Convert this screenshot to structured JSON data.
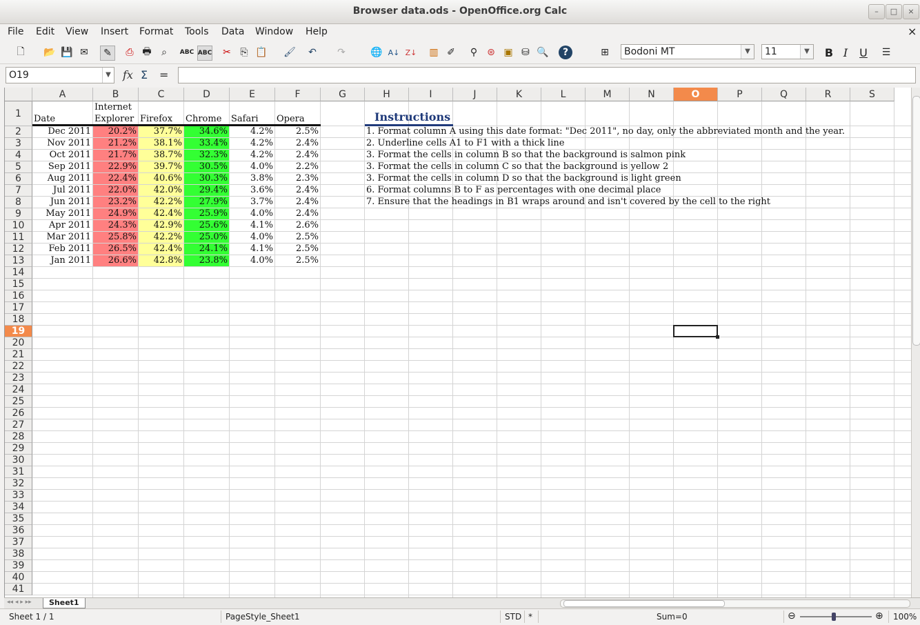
{
  "window": {
    "title": "Browser data.ods - OpenOffice.org Calc"
  },
  "menu": [
    "File",
    "Edit",
    "View",
    "Insert",
    "Format",
    "Tools",
    "Data",
    "Window",
    "Help"
  ],
  "toolbar": {
    "font_name": "Bodoni MT",
    "font_size": "11",
    "bold": "B",
    "italic": "I",
    "underline": "U"
  },
  "formula_bar": {
    "cell_ref": "O19",
    "formula": ""
  },
  "columns": [
    "A",
    "B",
    "C",
    "D",
    "E",
    "F",
    "G",
    "H",
    "I",
    "J",
    "K",
    "L",
    "M",
    "N",
    "O",
    "P",
    "Q",
    "R",
    "S"
  ],
  "selected_column": "O",
  "selected_row": "19",
  "row_count": 41,
  "headers": {
    "a": "Date",
    "b_line1": "Internet",
    "b_line2": "Explorer",
    "c": "Firefox",
    "d": "Chrome",
    "e": "Safari",
    "f": "Opera"
  },
  "rows": [
    [
      "Dec 2011",
      "20.2%",
      "37.7%",
      "34.6%",
      "4.2%",
      "2.5%"
    ],
    [
      "Nov 2011",
      "21.2%",
      "38.1%",
      "33.4%",
      "4.2%",
      "2.4%"
    ],
    [
      "Oct 2011",
      "21.7%",
      "38.7%",
      "32.3%",
      "4.2%",
      "2.4%"
    ],
    [
      "Sep 2011",
      "22.9%",
      "39.7%",
      "30.5%",
      "4.0%",
      "2.2%"
    ],
    [
      "Aug 2011",
      "22.4%",
      "40.6%",
      "30.3%",
      "3.8%",
      "2.3%"
    ],
    [
      "Jul 2011",
      "22.0%",
      "42.0%",
      "29.4%",
      "3.6%",
      "2.4%"
    ],
    [
      "Jun 2011",
      "23.2%",
      "42.2%",
      "27.9%",
      "3.7%",
      "2.4%"
    ],
    [
      "May 2011",
      "24.9%",
      "42.4%",
      "25.9%",
      "4.0%",
      "2.4%"
    ],
    [
      "Apr 2011",
      "24.3%",
      "42.9%",
      "25.6%",
      "4.1%",
      "2.6%"
    ],
    [
      "Mar 2011",
      "25.8%",
      "42.2%",
      "25.0%",
      "4.0%",
      "2.5%"
    ],
    [
      "Feb 2011",
      "26.5%",
      "42.4%",
      "24.1%",
      "4.1%",
      "2.5%"
    ],
    [
      "Jan 2011",
      "26.6%",
      "42.8%",
      "23.8%",
      "4.0%",
      "2.5%"
    ]
  ],
  "instructions": {
    "title": "Instructions",
    "lines": [
      "1. Format column A using this date format: \"Dec 2011\", no day, only the abbreviated month and the year.",
      "2. Underline cells A1 to F1 with a thick line",
      "3. Format the cells in column B so that the background is salmon pink",
      "3. Format the cells in column C so that the background is yellow 2",
      "3. Format the cells in column D so that the background is light green",
      "6. Format columns B to F as percentages with one decimal place",
      "7. Ensure that the headings in B1 wraps around and isn't covered by the cell to the right"
    ]
  },
  "sheet_tab": "Sheet1",
  "status": {
    "sheet": "Sheet 1 / 1",
    "page_style": "PageStyle_Sheet1",
    "mode": "STD",
    "modified": "*",
    "sum": "Sum=0",
    "zoom": "100%"
  },
  "colors": {
    "salmon": "#ff8080",
    "yellow": "#ffff99",
    "green": "#33ff33",
    "selection": "#f38a4b",
    "instructions_title": "#1f3a7a"
  }
}
